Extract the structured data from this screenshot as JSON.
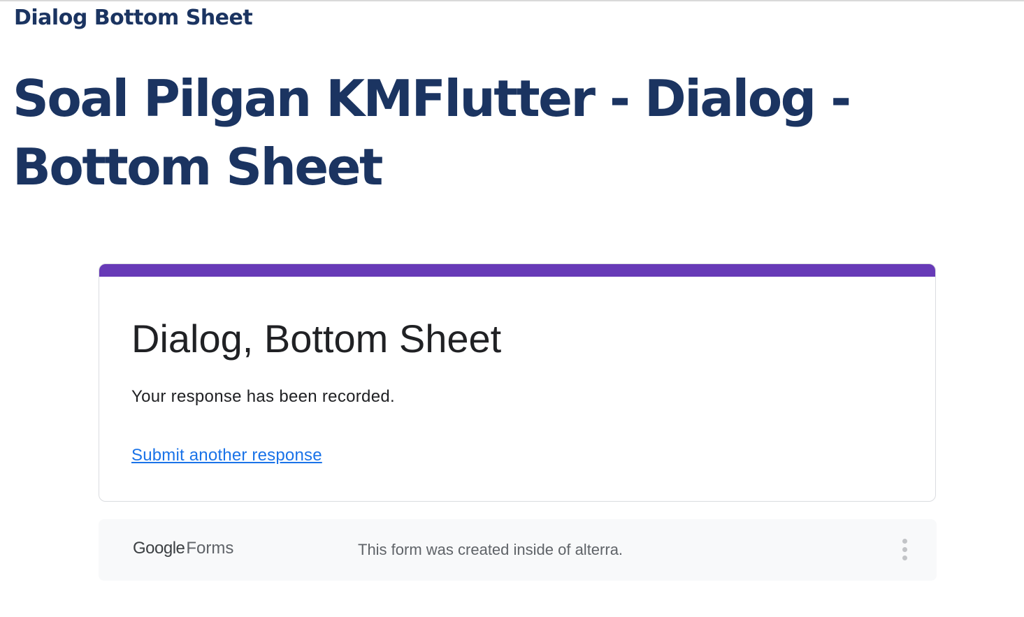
{
  "page": {
    "breadcrumb_title": "Dialog Bottom Sheet",
    "heading": "Soal Pilgan KMFlutter - Dialog - Bottom Sheet"
  },
  "form": {
    "accent_color": "#673ab7",
    "title": "Dialog, Bottom Sheet",
    "confirmation_message": "Your response has been recorded.",
    "submit_another_link": "Submit another response"
  },
  "footer": {
    "brand_google": "Google",
    "brand_forms": "Forms",
    "note": "This form was created inside of alterra.",
    "more_icon": "more-vertical-icon"
  },
  "colors": {
    "heading": "#1b3461",
    "link": "#1a73e8",
    "footer_background": "#f8f9fa"
  }
}
